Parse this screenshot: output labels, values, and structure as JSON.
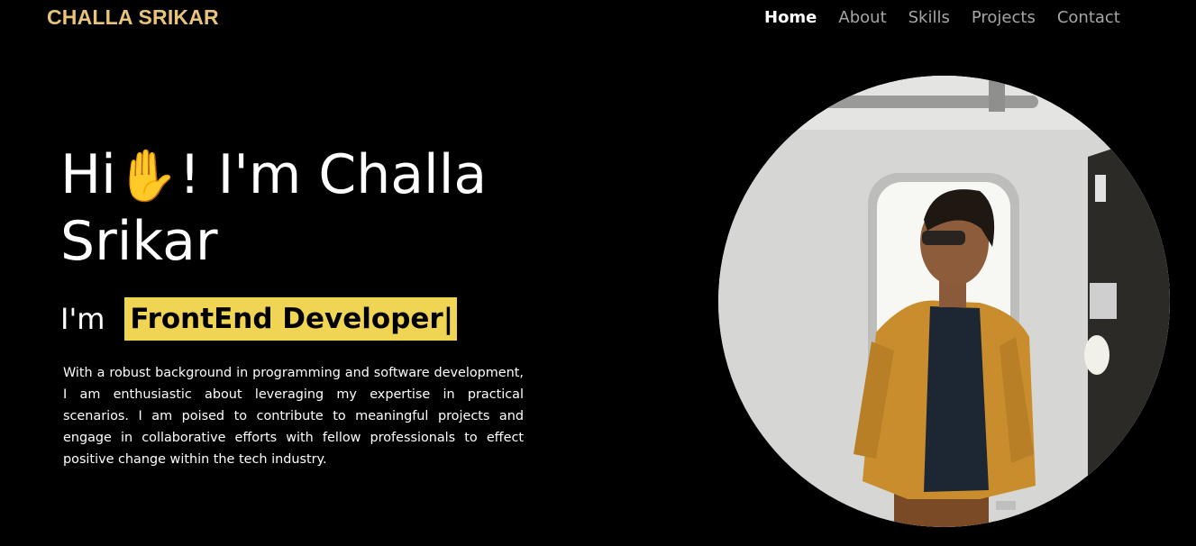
{
  "brand": "CHALLA SRIKAR",
  "nav": {
    "items": [
      "Home",
      "About",
      "Skills",
      "Projects",
      "Contact"
    ],
    "active": "Home"
  },
  "hero": {
    "greeting_before": "Hi",
    "wave_emoji": "✋",
    "greeting_after": "! I'm Challa Srikar",
    "im": "I'm",
    "role": "FrontEnd Developer",
    "cursor": "|",
    "about": "With a robust background in programming and software development, I am enthusiastic about leveraging my expertise in practical scenarios. I am poised to contribute to meaningful projects and engage in collaborative efforts with fellow professionals to effect positive change within the tech industry."
  },
  "colors": {
    "background": "#000000",
    "brand": "#e8c37a",
    "nav_inactive": "#a6a6a6",
    "nav_active": "#ffffff",
    "highlight": "#f0d453"
  },
  "portrait": {
    "alt": "profile-photo"
  }
}
